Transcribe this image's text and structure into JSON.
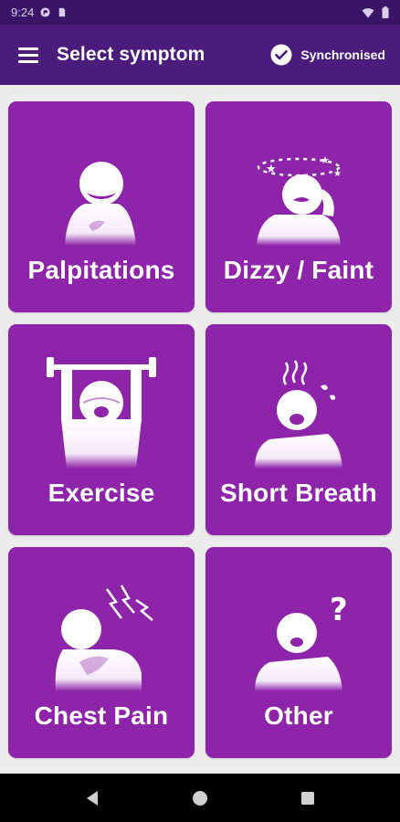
{
  "status_bar": {
    "time": "9:24",
    "icons": [
      "circle-app-icon",
      "sd-card-icon",
      "wifi-icon",
      "battery-icon"
    ]
  },
  "app_bar": {
    "menu_icon": "hamburger-menu-icon",
    "title": "Select symptom",
    "sync_icon": "check-circle-icon",
    "sync_label": "Synchronised"
  },
  "theme": {
    "status_bar_color": "#3a1466",
    "app_bar_color": "#4a1c7c",
    "tile_color": "#8e24aa",
    "background": "#ececec"
  },
  "symptoms": [
    {
      "label": "Palpitations",
      "icon": "palpitations-icon"
    },
    {
      "label": "Dizzy / Faint",
      "icon": "dizzy-faint-icon"
    },
    {
      "label": "Exercise",
      "icon": "exercise-icon"
    },
    {
      "label": "Short Breath",
      "icon": "short-breath-icon"
    },
    {
      "label": "Chest Pain",
      "icon": "chest-pain-icon"
    },
    {
      "label": "Other",
      "icon": "other-icon"
    }
  ],
  "nav_bar": {
    "buttons": [
      "back-icon",
      "home-icon",
      "recents-icon"
    ]
  }
}
